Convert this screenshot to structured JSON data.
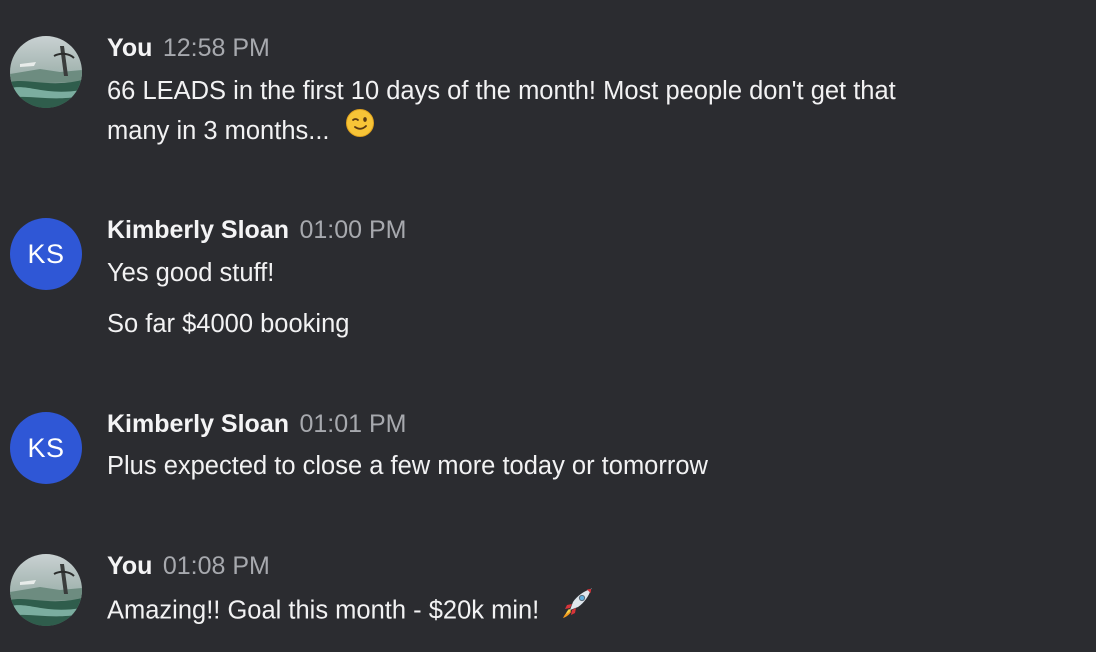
{
  "messages": [
    {
      "author": "You",
      "time": "12:58 PM",
      "avatar": {
        "kind": "photo",
        "icon": "landscape-photo-icon"
      },
      "lines": [
        "66 LEADS in the first 10 days of the month! Most people don't get that",
        "many in 3 months..."
      ],
      "emoji": "winking-face-icon"
    },
    {
      "author": "Kimberly Sloan",
      "time": "01:00 PM",
      "avatar": {
        "kind": "initials",
        "initials": "KS",
        "color": "#2f57d6"
      },
      "lines": [
        "Yes good stuff!",
        "So far $4000 booking"
      ]
    },
    {
      "author": "Kimberly Sloan",
      "time": "01:01 PM",
      "avatar": {
        "kind": "initials",
        "initials": "KS",
        "color": "#2f57d6"
      },
      "lines": [
        "Plus expected to close a few more today or tomorrow"
      ]
    },
    {
      "author": "You",
      "time": "01:08 PM",
      "avatar": {
        "kind": "photo",
        "icon": "landscape-photo-icon"
      },
      "lines": [
        "Amazing!! Goal this month - $20k min!"
      ],
      "emoji": "rocket-icon"
    }
  ],
  "colors": {
    "background": "#2b2c30",
    "text": "#f2f2f3",
    "timestamp": "#a7a9ae",
    "avatar_initials_bg": "#2f57d6"
  }
}
